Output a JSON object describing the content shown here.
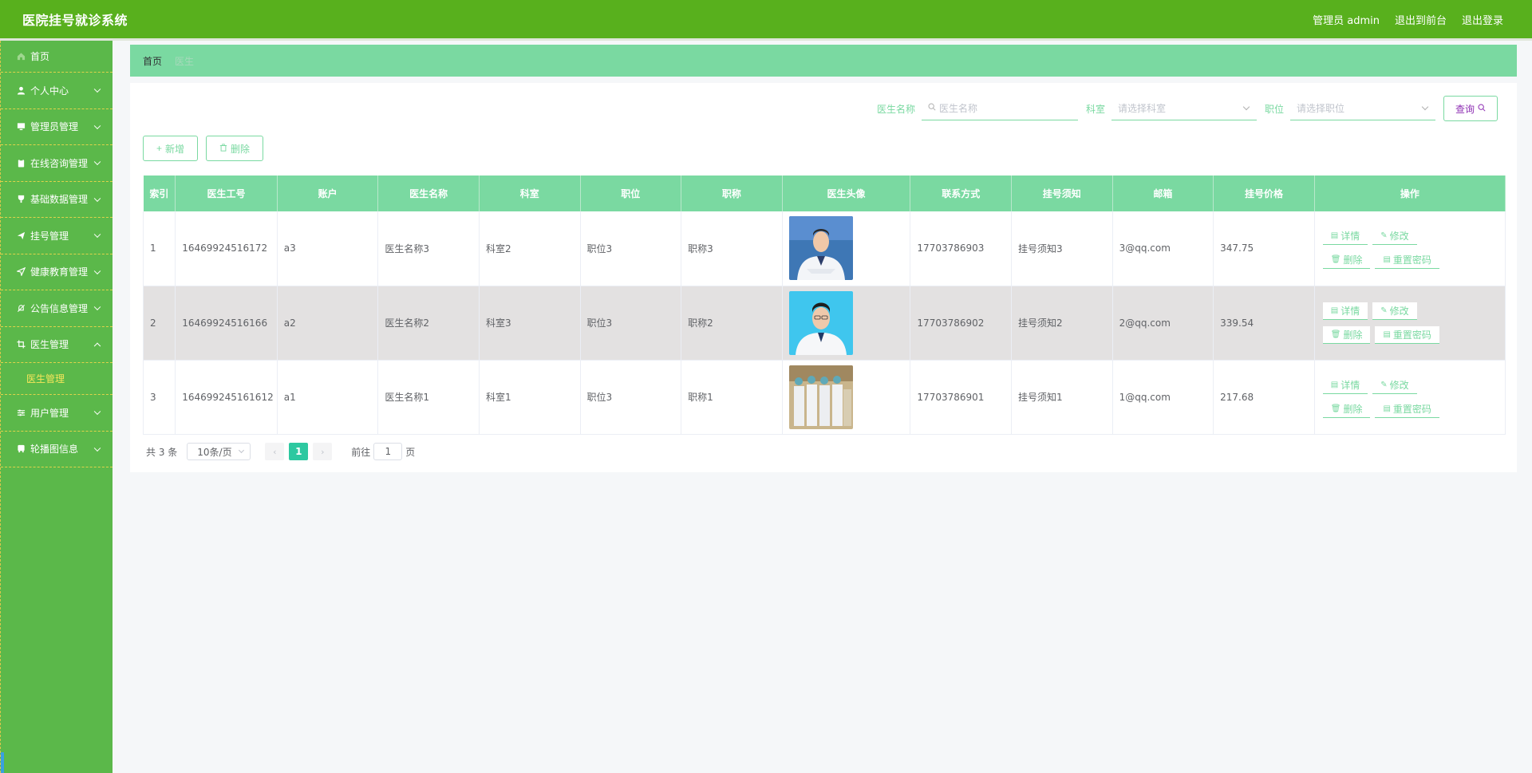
{
  "app": {
    "title": "医院挂号就诊系统",
    "user_label": "管理员 admin",
    "front_label": "退出到前台",
    "logout_label": "退出登录"
  },
  "sidebar": {
    "items": [
      {
        "label": "首页",
        "icon": "home-icon"
      },
      {
        "label": "个人中心",
        "icon": "user-icon"
      },
      {
        "label": "管理员管理",
        "icon": "monitor-icon"
      },
      {
        "label": "在线咨询管理",
        "icon": "clipboard-icon"
      },
      {
        "label": "基础数据管理",
        "icon": "trophy-icon"
      },
      {
        "label": "挂号管理",
        "icon": "send-icon"
      },
      {
        "label": "健康教育管理",
        "icon": "navigation-icon"
      },
      {
        "label": "公告信息管理",
        "icon": "bell-off-icon"
      },
      {
        "label": "医生管理",
        "icon": "crop-icon"
      },
      {
        "label": "用户管理",
        "icon": "sliders-icon"
      },
      {
        "label": "轮播图信息",
        "icon": "bus-icon"
      }
    ],
    "subitem": "医生管理"
  },
  "breadcrumb": {
    "home": "首页",
    "current": "医生"
  },
  "search": {
    "name_label": "医生名称",
    "name_placeholder": "医生名称",
    "dept_label": "科室",
    "dept_placeholder": "请选择科室",
    "position_label": "职位",
    "position_placeholder": "请选择职位",
    "query_label": "查询"
  },
  "actions": {
    "add": "新增",
    "delete": "删除"
  },
  "table": {
    "headers": [
      "索引",
      "医生工号",
      "账户",
      "医生名称",
      "科室",
      "职位",
      "职称",
      "医生头像",
      "联系方式",
      "挂号须知",
      "邮箱",
      "挂号价格",
      "操作"
    ],
    "rows": [
      {
        "index": "1",
        "code": "16469924516172",
        "account": "a3",
        "name": "医生名称3",
        "dept": "科室2",
        "position": "职位3",
        "title": "职称3",
        "phone": "17703786903",
        "notice": "挂号须知3",
        "email": "3@qq.com",
        "price": "347.75"
      },
      {
        "index": "2",
        "code": "16469924516166",
        "account": "a2",
        "name": "医生名称2",
        "dept": "科室3",
        "position": "职位3",
        "title": "职称2",
        "phone": "17703786902",
        "notice": "挂号须知2",
        "email": "2@qq.com",
        "price": "339.54"
      },
      {
        "index": "3",
        "code": "164699245161612",
        "account": "a1",
        "name": "医生名称1",
        "dept": "科室1",
        "position": "职位3",
        "title": "职称1",
        "phone": "17703786901",
        "notice": "挂号须知1",
        "email": "1@qq.com",
        "price": "217.68"
      }
    ],
    "ops": {
      "detail": "详情",
      "edit": "修改",
      "delete": "删除",
      "reset": "重置密码"
    }
  },
  "pagination": {
    "total": "共 3 条",
    "page_size": "10条/页",
    "current_page": "1",
    "goto_prefix": "前往",
    "goto_value": "1",
    "goto_suffix": "页"
  },
  "colors": {
    "header_green": "#58b01d",
    "sidebar_green": "#5bb84a",
    "accent": "#7ad9a1",
    "pager_active": "#2dc8a0"
  }
}
